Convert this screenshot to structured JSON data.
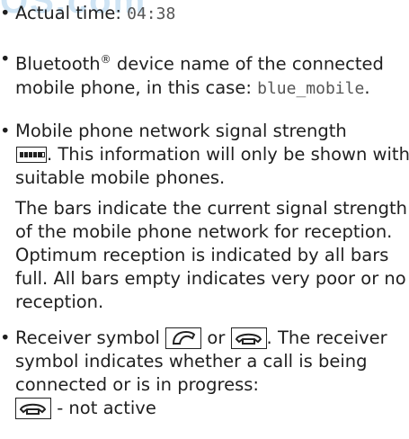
{
  "watermark": "OS.com",
  "items": [
    {
      "label": "Actual time: ",
      "value": "04:38"
    },
    {
      "label": "Bluetooth",
      "sup": "®",
      "label2": " device name of the connected mobile phone, in this case: ",
      "value": "blue_mobile",
      "tail": "."
    },
    {
      "line1": "Mobile phone network signal strength",
      "after_icon": ". This information will only be shown with suitable mobile phones.",
      "para2": "The bars indicate the current signal strength of the mobile phone network for reception. Optimum reception is indicated by all bars full. All bars empty indicates very poor or no reception."
    },
    {
      "label": "Receiver symbol ",
      "or": " or ",
      "after_icons": ". The receiver symbol indicates whether a call is being connected or is in progress:",
      "not_active": " - not active"
    }
  ],
  "icons": [
    "signal-strength-icon",
    "receiver-active-icon",
    "receiver-inactive-icon"
  ]
}
